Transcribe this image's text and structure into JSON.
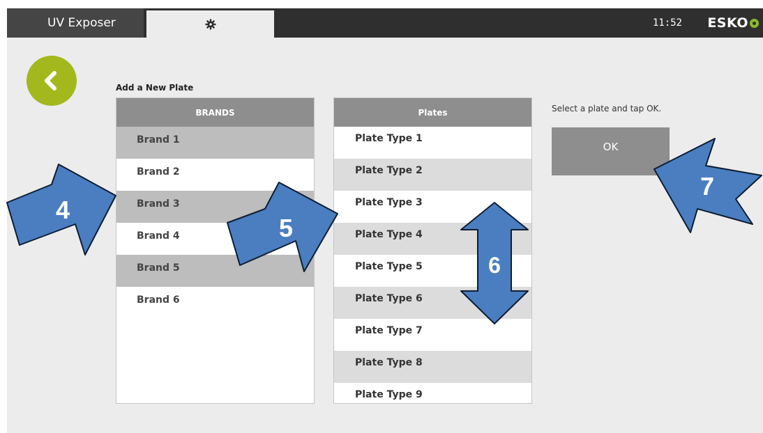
{
  "topbar": {
    "app_tab": "UV Exposer",
    "settings_icon": "gear-icon",
    "clock": "11:52",
    "logo": "ESKO"
  },
  "back_button": {
    "icon": "chevron-left-icon"
  },
  "page": {
    "title": "Add a New Plate"
  },
  "brands": {
    "header": "BRANDS",
    "items": [
      "Brand 1",
      "Brand 2",
      "Brand 3",
      "Brand 4",
      "Brand 5",
      "Brand 6"
    ]
  },
  "plates": {
    "header": "Plates",
    "items": [
      "Plate Type 1",
      "Plate Type 2",
      "Plate Type 3",
      "Plate Type 4",
      "Plate Type 5",
      "Plate Type 6",
      "Plate Type 7",
      "Plate Type 8",
      "Plate Type 9"
    ]
  },
  "instructions": "Select a plate and tap OK.",
  "ok_label": "OK",
  "callouts": [
    "4",
    "5",
    "6",
    "7"
  ],
  "colors": {
    "accent_green": "#a3b81d",
    "callout_blue": "#4a7ec0",
    "topbar": "#2f2f2f"
  }
}
